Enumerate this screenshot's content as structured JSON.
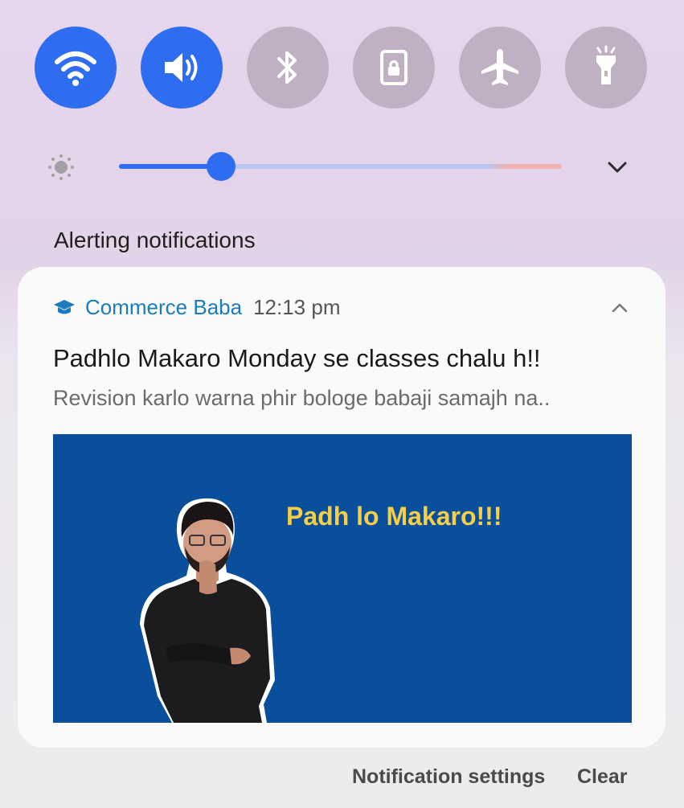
{
  "quick_settings": {
    "toggles": [
      {
        "name": "wifi",
        "icon": "wifi-icon",
        "on": true
      },
      {
        "name": "sound",
        "icon": "volume-icon",
        "on": true
      },
      {
        "name": "bluetooth",
        "icon": "bluetooth-icon",
        "on": false
      },
      {
        "name": "screen-lock",
        "icon": "lock-icon",
        "on": false
      },
      {
        "name": "airplane",
        "icon": "airplane-icon",
        "on": false
      },
      {
        "name": "flashlight",
        "icon": "flashlight-icon",
        "on": false
      }
    ],
    "brightness_level": 0.23,
    "accent_color": "#2f6df0"
  },
  "section": {
    "title": "Alerting notifications"
  },
  "notification": {
    "app_icon": "graduation-cap-icon",
    "app_name": "Commerce Baba",
    "time": "12:13 pm",
    "title": "Padhlo Makaro Monday se classes chalu h!!",
    "body": "Revision karlo warna phir bologe babaji samajh na..",
    "image_caption": "Padh lo Makaro!!!",
    "app_color": "#1b7bbd",
    "banner_color": "#0a4f9c"
  },
  "footer": {
    "settings_label": "Notification settings",
    "clear_label": "Clear"
  }
}
